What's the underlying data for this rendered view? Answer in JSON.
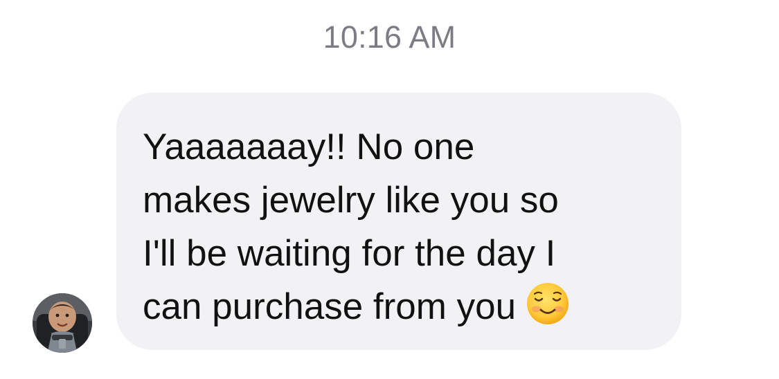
{
  "timestamp": "10:16 AM",
  "message": {
    "lines": [
      "Yaaaaaaay!! No one",
      "makes jewelry like you so",
      "I'll be waiting for the day I",
      "can purchase from you"
    ],
    "emoji": "smiling-face-emoji",
    "bubble_color": "#f2f2f5",
    "text_color": "#111111"
  },
  "sender": {
    "avatar": "baby-photo-avatar"
  },
  "colors": {
    "timestamp": "#7c7c84",
    "background": "#ffffff"
  }
}
